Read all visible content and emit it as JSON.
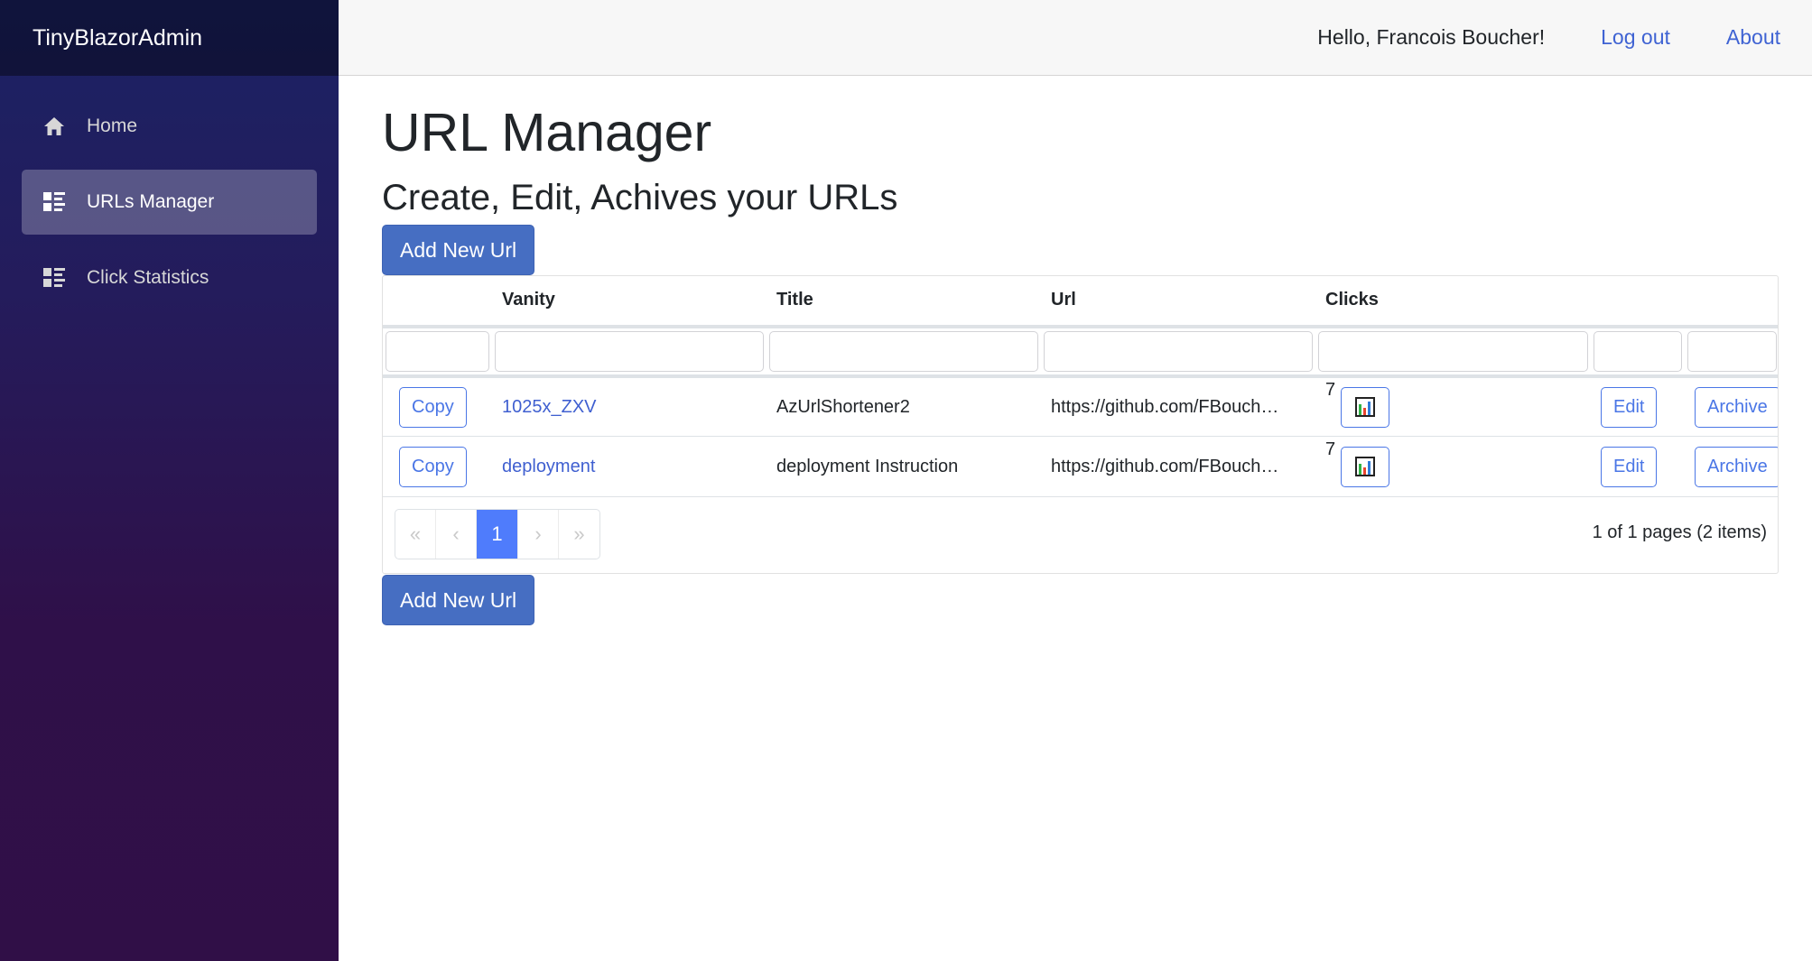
{
  "app": {
    "brand": "TinyBlazorAdmin"
  },
  "sidebar": {
    "items": [
      {
        "label": "Home",
        "icon": "home-icon",
        "active": false
      },
      {
        "label": "URLs Manager",
        "icon": "list-icon",
        "active": true
      },
      {
        "label": "Click Statistics",
        "icon": "list-icon",
        "active": false
      }
    ]
  },
  "topbar": {
    "greeting": "Hello, Francois Boucher!",
    "logout_label": "Log out",
    "about_label": "About"
  },
  "page": {
    "title": "URL Manager",
    "subtitle": "Create, Edit, Achives your URLs",
    "add_button_label": "Add New Url"
  },
  "grid": {
    "columns": [
      "",
      "Vanity",
      "Title",
      "Url",
      "Clicks",
      "",
      ""
    ],
    "rows": [
      {
        "copy_label": "Copy",
        "vanity": "1025x_ZXV",
        "title": "AzUrlShortener2",
        "url": "https://github.com/FBouch…",
        "clicks": "7",
        "stats_icon": "bar-chart-icon",
        "edit_label": "Edit",
        "archive_label": "Archive"
      },
      {
        "copy_label": "Copy",
        "vanity": "deployment",
        "title": "deployment Instruction",
        "url": "https://github.com/FBouch…",
        "clicks": "7",
        "stats_icon": "bar-chart-icon",
        "edit_label": "Edit",
        "archive_label": "Archive"
      }
    ],
    "pager": {
      "first": "«",
      "prev": "‹",
      "current": "1",
      "next": "›",
      "last": "»",
      "summary": "1 of 1 pages (2 items)"
    }
  },
  "colors": {
    "primary": "#466ec2",
    "link": "#3f63d3",
    "pager_active": "#4f7cfc",
    "sidebar_top": "#1b2264",
    "sidebar_bottom": "#300f47"
  }
}
